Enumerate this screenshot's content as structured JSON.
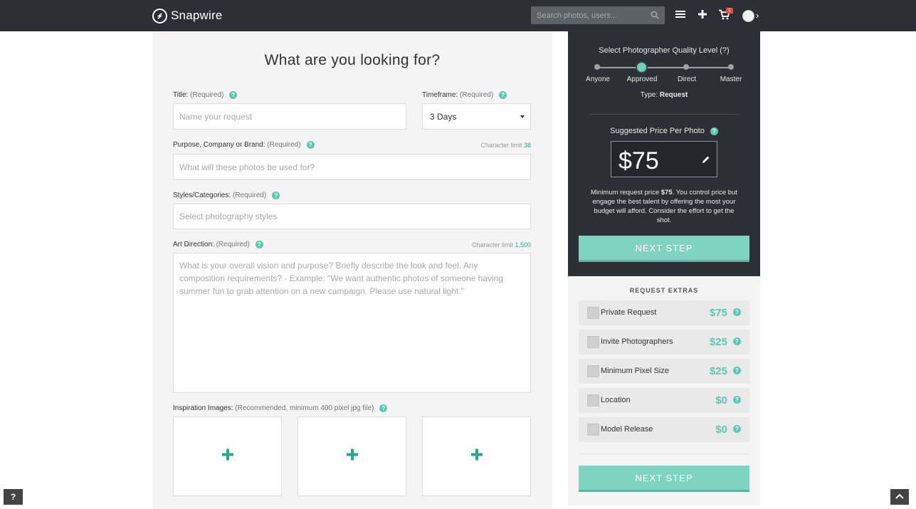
{
  "app": {
    "name": "Snapwire"
  },
  "nav": {
    "search_placeholder": "Search photos, users...",
    "cart_count": "1",
    "icons": [
      "menu-icon",
      "plus-icon",
      "cart-icon",
      "avatar",
      "chevron-right-icon"
    ]
  },
  "form": {
    "title": "What are you looking for?",
    "title_field": {
      "label": "Title:",
      "req": "(Required)",
      "placeholder": "Name your request"
    },
    "timeframe": {
      "label": "Timeframe:",
      "req": "(Required)",
      "value": "3 Days"
    },
    "purpose": {
      "label": "Purpose, Company or Brand:",
      "req": "(Required)",
      "charlimit_label": "Character limit",
      "charlimit": "38",
      "placeholder": "What will these photos be used for?"
    },
    "styles": {
      "label": "Styles/Categories:",
      "req": "(Required)",
      "placeholder": "Select photography styles"
    },
    "art": {
      "label": "Art Direction:",
      "req": "(Required)",
      "charlimit_label": "Character limit",
      "charlimit": "1,500",
      "placeholder": "What is your overall vision and purpose? Briefly describe the look and feel. Any composition requirements? - Example: \"We want authentic photos of someone having summer fun to grab attention on a new campaign. Please use natural light.\""
    },
    "inspiration": {
      "label": "Inspiration Images:",
      "req": "(Recommended, minimum 400 pixel jpg file)"
    }
  },
  "quality": {
    "title": "Select Photographer Quality Level (?)",
    "levels": [
      "Anyone",
      "Approved",
      "Direct",
      "Master"
    ],
    "selected_level": "Approved",
    "type_label": "Type:",
    "type_value": "Request"
  },
  "price": {
    "title": "Suggested Price Per Photo",
    "amount": "$75",
    "note_prefix": "Minimum request price ",
    "note_amount": "$75",
    "note_suffix": ". You control price but engage the best talent by offering the most your budget will afford. Consider the effort to get the shot.",
    "next_label": "NEXT STEP"
  },
  "extras": {
    "title": "REQUEST EXTRAS",
    "items": [
      {
        "name": "Private Request",
        "price": "$75"
      },
      {
        "name": "Invite Photographers",
        "price": "$25"
      },
      {
        "name": "Minimum Pixel Size",
        "price": "$25"
      },
      {
        "name": "Location",
        "price": "$0"
      },
      {
        "name": "Model Release",
        "price": "$0"
      }
    ],
    "next_label": "NEXT STEP"
  },
  "help_button": "?",
  "colors": {
    "accent": "#5ec7b0",
    "button": "#7ed3c1",
    "dark": "#2c3036"
  }
}
